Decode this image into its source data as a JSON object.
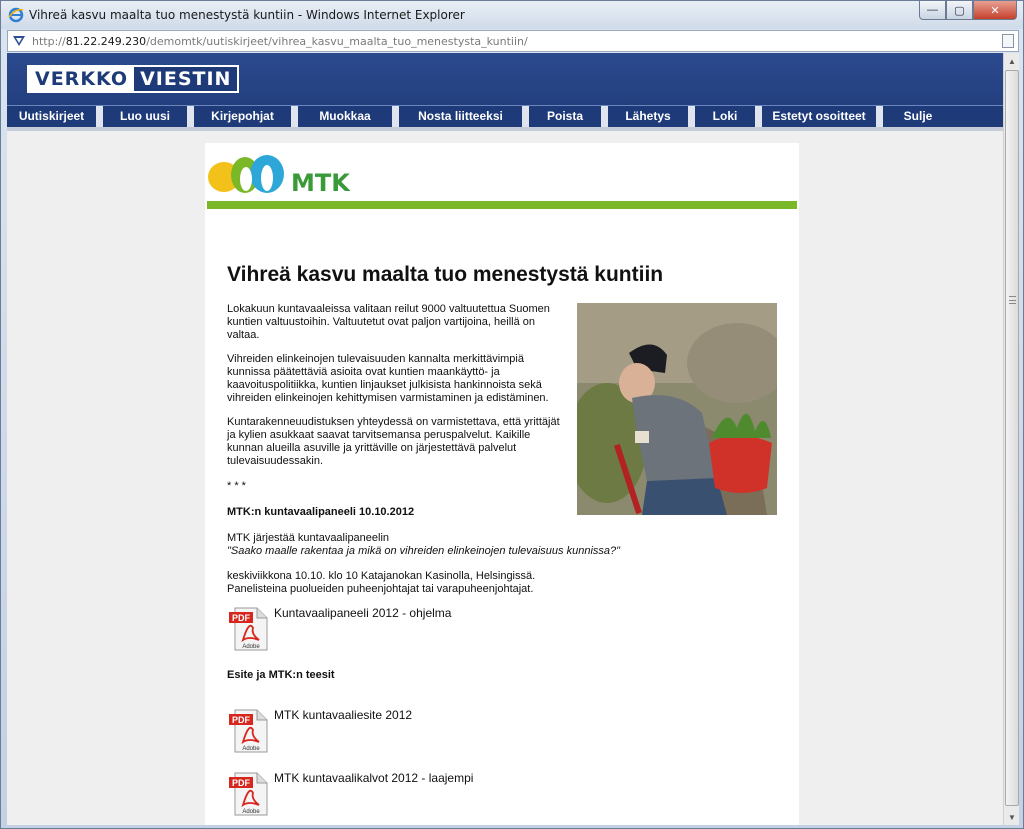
{
  "window": {
    "title": "Vihreä kasvu maalta tuo menestystä kuntiin - Windows Internet Explorer",
    "minimize_glyph": "—",
    "maximize_glyph": "▢",
    "close_glyph": "✕"
  },
  "address": {
    "prefix": "http://",
    "host": "81.22.249.230",
    "path": "/demomtk/uutiskirjeet/vihrea_kasvu_maalta_tuo_menestysta_kuntiin/"
  },
  "app": {
    "logo_part1": "VERKKO",
    "logo_part2": "VIESTIN"
  },
  "menu": [
    {
      "label": "Uutiskirjeet"
    },
    {
      "label": "Luo uusi"
    },
    {
      "label": "Kirjepohjat"
    },
    {
      "label": "Muokkaa"
    },
    {
      "label": "Nosta liitteeksi"
    },
    {
      "label": "Poista"
    },
    {
      "label": "Lähetys"
    },
    {
      "label": "Loki"
    },
    {
      "label": "Estetyt osoitteet"
    },
    {
      "label": "Sulje"
    }
  ],
  "newsletter": {
    "brand": "MTK",
    "headline": "Vihreä kasvu maalta tuo menestystä kuntiin",
    "para1": "Lokakuun kuntavaaleissa valitaan reilut 9000 valtuutettua Suomen kuntien valtuustoihin. Valtuutetut ovat paljon vartijoina, heillä on valtaa.",
    "para2": "Vihreiden elinkeinojen tulevaisuuden kannalta merkittävimpiä kunnissa päätettäviä asioita ovat kuntien maankäyttö- ja kaavoituspolitiikka, kuntien linjaukset julkisista hankinnoista sekä vihreiden elinkeinojen kehittymisen varmistaminen ja edistäminen.",
    "para3": "Kuntarakenneuudistuksen yhteydessä on varmistettava, että yrittäjät ja kylien asukkaat saavat tarvitsemansa peruspalvelut. Kaikille kunnan alueilla asuville ja yrittäville on järjestettävä palvelut tulevaisuudessakin.",
    "separator": "* * *",
    "panel_heading": "MTK:n kuntavaalipaneeli 10.10.2012",
    "panel_intro": "MTK järjestää kuntavaalipaneelin",
    "panel_quote": "\"Saako maalle rakentaa ja mikä on vihreiden elinkeinojen tulevaisuus kunnissa?\"",
    "panel_time": "keskiviikkona 10.10. klo 10 Katajanokan Kasinolla, Helsingissä.",
    "panel_panelists": "Panelisteina puolueiden puheenjohtajat tai varapuheenjohtajat.",
    "esite_heading": "Esite ja MTK:n teesit",
    "attachments": [
      {
        "label": "Kuntavaalipaneeli 2012 - ohjelma"
      },
      {
        "label": "MTK kuntavaaliesite 2012"
      },
      {
        "label": "MTK kuntavaalikalvot 2012 - laajempi"
      }
    ],
    "pdf_badge": "PDF",
    "pdf_vendor": "Adobe"
  },
  "colors": {
    "header_blue": "#233f7e",
    "mtk_green": "#7ab828",
    "pdf_red": "#d7261e"
  }
}
